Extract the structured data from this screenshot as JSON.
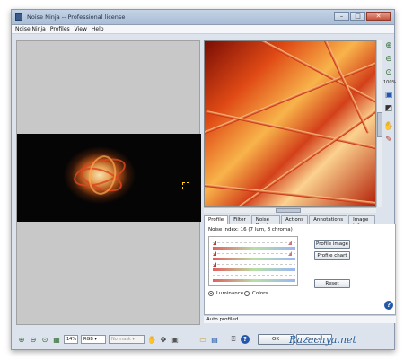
{
  "window": {
    "title": "Noise Ninja -- Professional license",
    "controls": {
      "minimize": "–",
      "maximize": "□",
      "close": "✕"
    }
  },
  "menu": [
    "Noise Ninja",
    "Profiles",
    "View",
    "Help"
  ],
  "tools": {
    "zoom_level": "100%"
  },
  "tabs": [
    "Profile",
    "Filter",
    "Noise Brush",
    "Actions",
    "Annotations",
    "Image info"
  ],
  "active_tab": "Profile",
  "profile": {
    "noise_index": "Noise index:  16 (7 lum, 8 chroma)",
    "buttons": {
      "profile_image": "Profile image",
      "profile_chart": "Profile chart",
      "reset": "Reset"
    },
    "radios": {
      "luminance": "Luminance",
      "colors": "Colors"
    },
    "luminance_selected": true
  },
  "status": "Auto profiled",
  "bottom": {
    "zoom_pct": "14%",
    "color_mode": "RGB",
    "mask": "No mask",
    "ok": "OK",
    "cancel": "Cancel"
  },
  "watermark": "Razachya.net",
  "colors": {
    "accent": "#2358a8",
    "title_bg": "#b7c8de"
  }
}
